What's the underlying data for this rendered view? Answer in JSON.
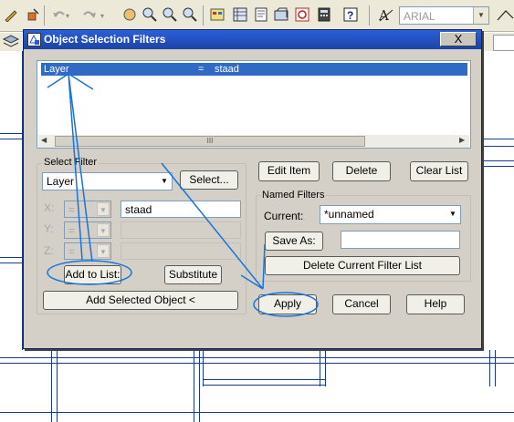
{
  "toolbar": {
    "font_value": "ARIAL",
    "icons": [
      "pencil-icon",
      "paint-icon",
      "undo-icon",
      "redo-icon",
      "pan-icon",
      "zoom-realtime-icon",
      "zoom-window-icon",
      "zoom-previous-icon",
      "properties-icon",
      "design-center-icon",
      "tool-palettes-icon",
      "sheet-set-icon",
      "markup-icon",
      "calculator-icon",
      "help-icon",
      "text-style-icon",
      "dimension-icon"
    ]
  },
  "dialog": {
    "title": "Object Selection Filters",
    "close_label": "X",
    "list": {
      "rows": [
        {
          "name": "Layer",
          "op": "=",
          "value": "staad"
        }
      ],
      "scroll_thumb": "III"
    },
    "select_filter": {
      "label": "Select Filter",
      "type_value": "Layer",
      "select_button": "Select...",
      "x_label": "X:",
      "y_label": "Y:",
      "z_label": "Z:",
      "x_op": "=",
      "y_op": "=",
      "z_op": "=",
      "x_value": "staad",
      "y_value": "",
      "z_value": "",
      "add_to_list": "Add to List:",
      "substitute": "Substitute",
      "add_selected": "Add Selected Object <"
    },
    "edit_item": "Edit Item",
    "delete": "Delete",
    "clear_list": "Clear List",
    "named_filters": {
      "label": "Named Filters",
      "current_label": "Current:",
      "current_value": "*unnamed",
      "save_as": "Save As:",
      "save_as_value": "",
      "delete_current": "Delete Current Filter List"
    },
    "apply": "Apply",
    "cancel": "Cancel",
    "help": "Help"
  },
  "colors": {
    "annotation": "#1a73d9",
    "selection": "#316ac5",
    "titlebar": "#2c5fd8"
  }
}
